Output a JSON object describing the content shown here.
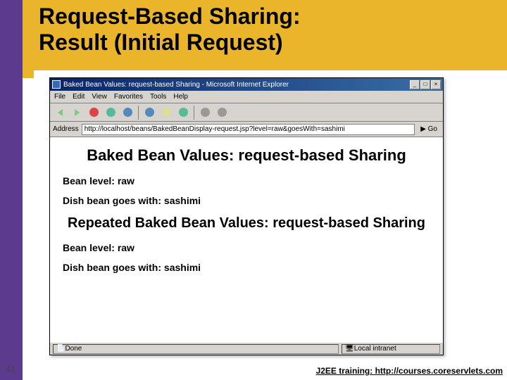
{
  "slide": {
    "title_line1": "Request-Based Sharing:",
    "title_line2": "Result (Initial Request)",
    "number": "41",
    "footer": "J2EE training: http://courses.coreservlets.com"
  },
  "browser": {
    "title": "Baked Bean Values: request-based Sharing - Microsoft Internet Explorer",
    "menu": {
      "file": "File",
      "edit": "Edit",
      "view": "View",
      "favorites": "Favorites",
      "tools": "Tools",
      "help": "Help"
    },
    "address_label": "Address",
    "address_value": "http://localhost/beans/BakedBeanDisplay-request.jsp?level=raw&goesWith=sashimi",
    "go": "Go",
    "status_done": "Done",
    "status_zone": "Local intranet"
  },
  "page": {
    "h1": "Baked Bean Values: request-based Sharing",
    "p1": "Bean level: raw",
    "p2": "Dish bean goes with: sashimi",
    "h2": "Repeated Baked Bean Values: request-based Sharing",
    "p3": "Bean level: raw",
    "p4": "Dish bean goes with: sashimi"
  }
}
